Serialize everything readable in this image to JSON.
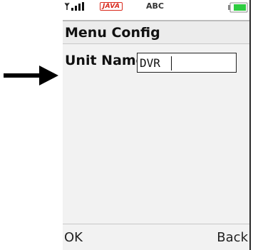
{
  "status_bar": {
    "signal_icon": "signal-bars-icon",
    "java_label": "JAVA",
    "input_mode": "ABC",
    "battery_icon": "battery-icon",
    "battery_color": "#2ecc40"
  },
  "screen": {
    "title": "Menu Config",
    "field": {
      "label": "Unit Name",
      "value": "DVR",
      "placeholder": ""
    }
  },
  "softkeys": {
    "left": "OK",
    "right": "Back"
  },
  "annotation": {
    "arrow_icon": "pointer-arrow-icon",
    "arrow_color": "#000000"
  }
}
